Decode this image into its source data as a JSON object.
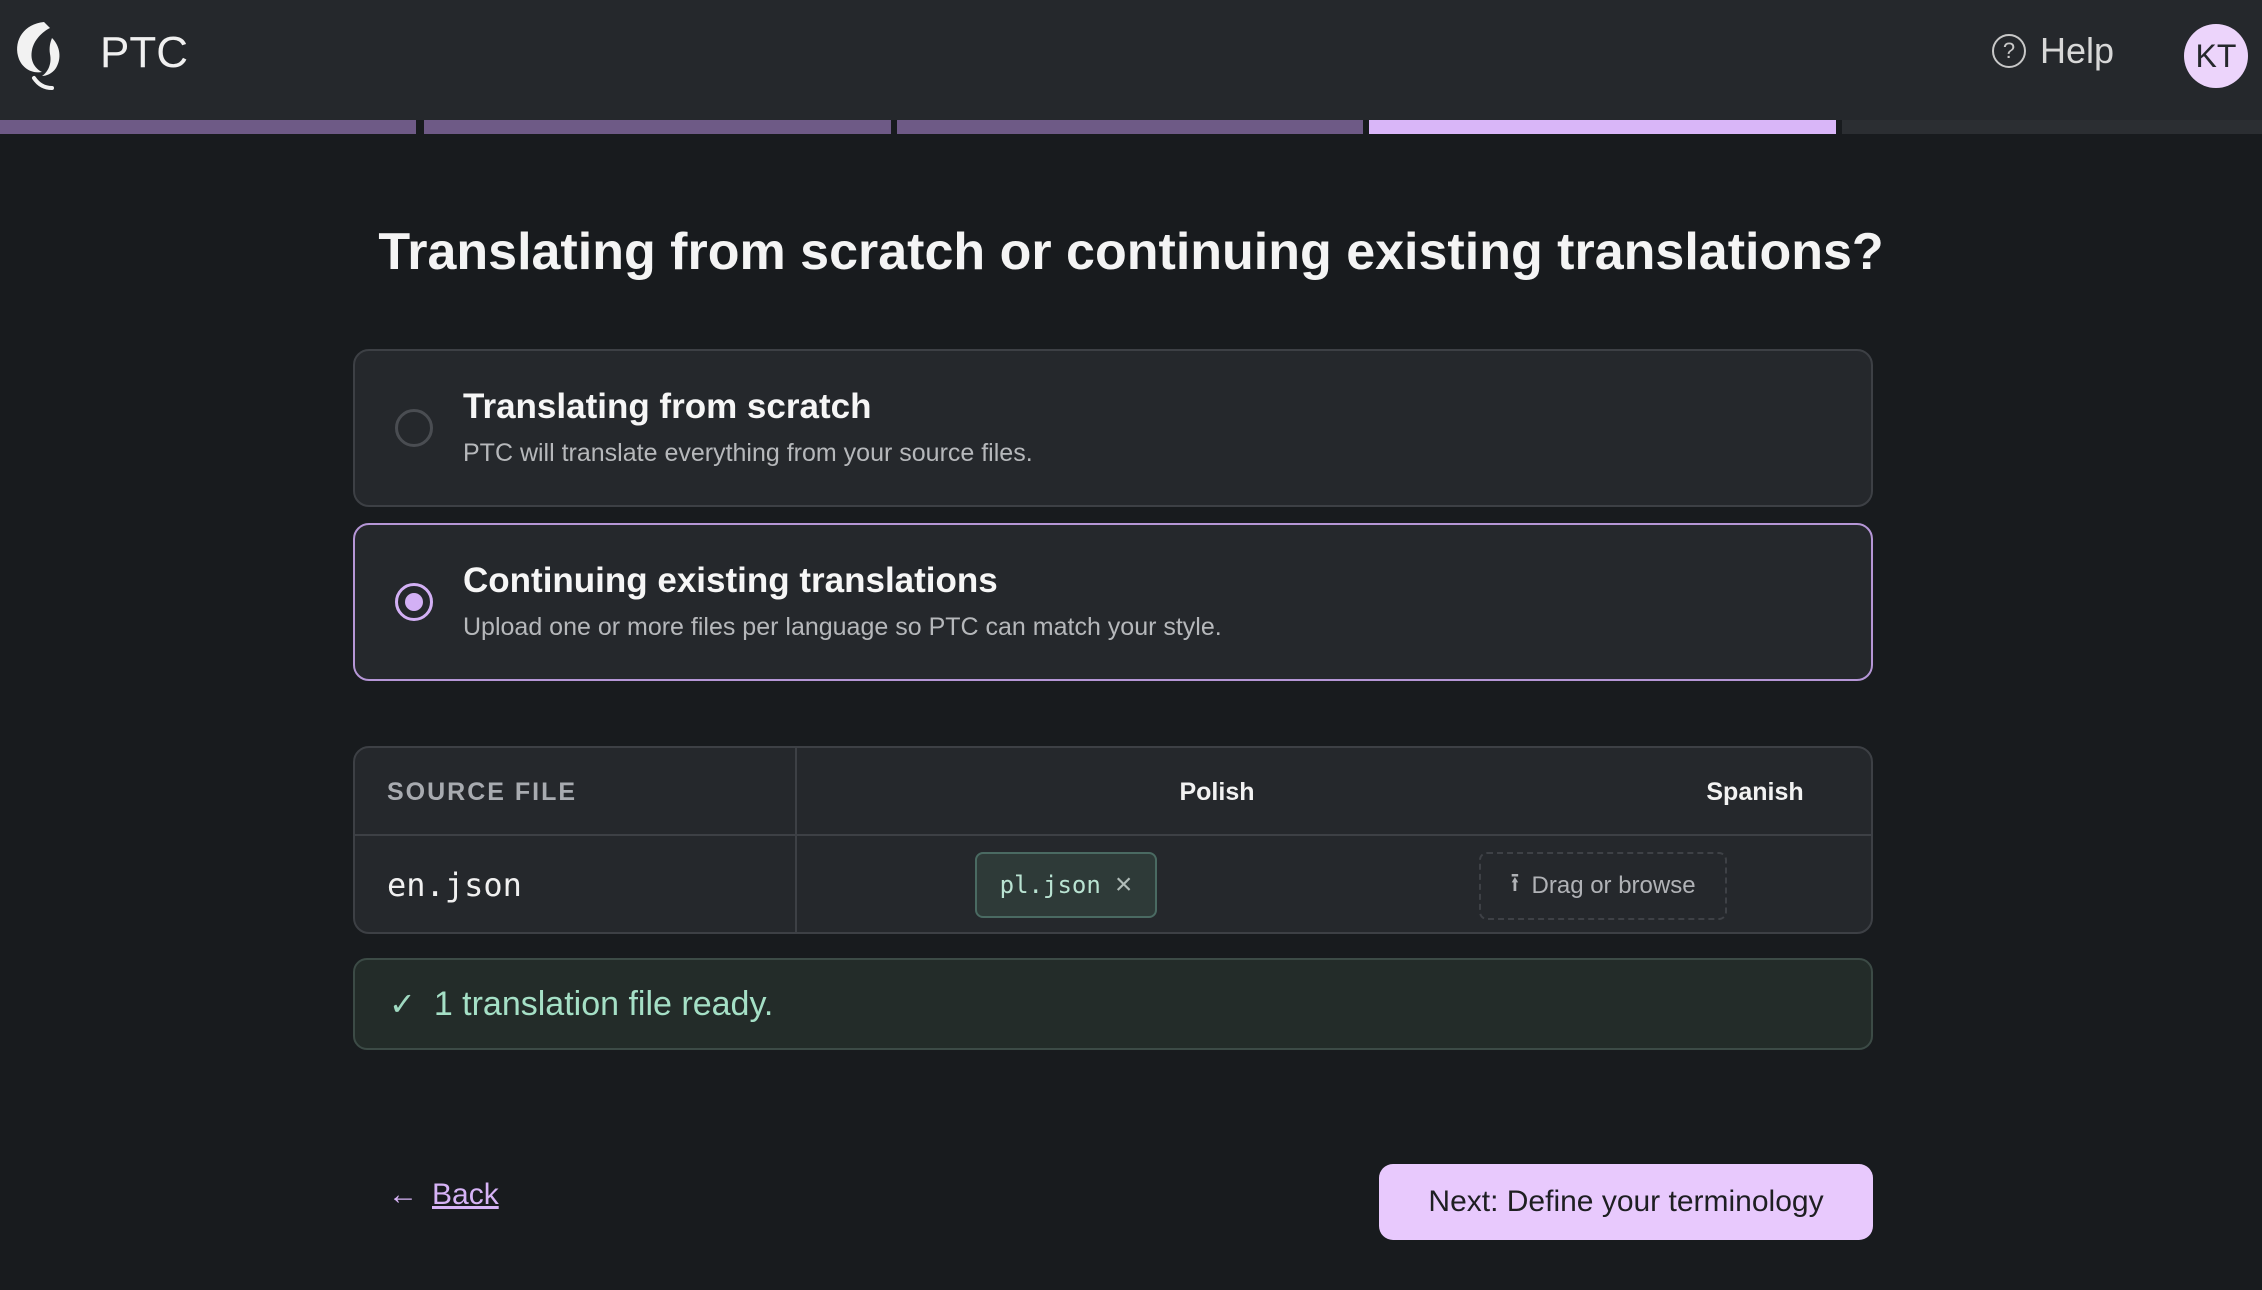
{
  "header": {
    "brand": "PTC",
    "help_label": "Help",
    "help_icon": "question-circle-icon",
    "avatar_initials": "KT"
  },
  "progress": {
    "total_steps": 5,
    "current_step": 4,
    "colors": {
      "done": "#6e5a86",
      "active": "#d9b6f8",
      "todo": "#2b2e32"
    }
  },
  "page": {
    "title": "Translating from scratch or continuing existing translations?"
  },
  "options": [
    {
      "title": "Translating from scratch",
      "description": "PTC will translate everything from your source files.",
      "selected": false
    },
    {
      "title": "Continuing existing translations",
      "description": "Upload one or more files per language so PTC can match your style.",
      "selected": true
    }
  ],
  "table": {
    "headers": {
      "source": "SOURCE FILE",
      "lang1": "Polish",
      "lang2": "Spanish"
    },
    "rows": [
      {
        "source": "en.json",
        "polish_file": "pl.json",
        "spanish_drop_label": "Drag or browse"
      }
    ]
  },
  "status": {
    "message": "1 translation file ready.",
    "icon": "check-icon",
    "color": "#a5e0c6"
  },
  "footer": {
    "back_label": "Back",
    "next_label": "Next: Define your terminology"
  },
  "theme": {
    "accent": "#e8c9fd",
    "background": "#181b1e",
    "surface": "#25282c"
  }
}
